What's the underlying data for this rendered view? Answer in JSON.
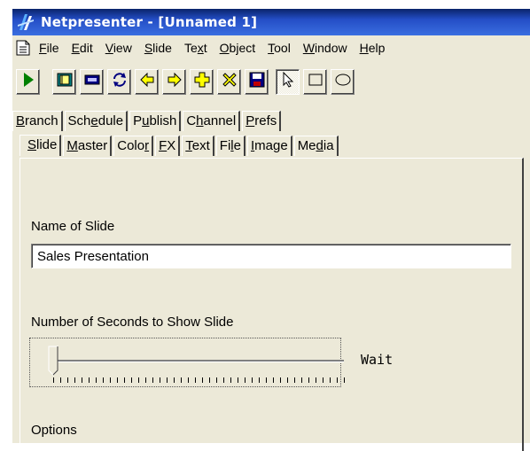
{
  "window": {
    "title": "Netpresenter - [Unnamed 1]"
  },
  "menu": {
    "items": [
      {
        "pre": "",
        "key": "F",
        "post": "ile"
      },
      {
        "pre": "",
        "key": "E",
        "post": "dit"
      },
      {
        "pre": "",
        "key": "V",
        "post": "iew"
      },
      {
        "pre": "",
        "key": "S",
        "post": "lide"
      },
      {
        "pre": "Te",
        "key": "x",
        "post": "t"
      },
      {
        "pre": "",
        "key": "O",
        "post": "bject"
      },
      {
        "pre": "",
        "key": "T",
        "post": "ool"
      },
      {
        "pre": "",
        "key": "W",
        "post": "indow"
      },
      {
        "pre": "",
        "key": "H",
        "post": "elp"
      }
    ]
  },
  "toolbar": {
    "buttons": [
      "play-icon",
      "open-slide-icon",
      "screen-icon",
      "refresh-icon",
      "left-arrow-icon",
      "right-arrow-icon",
      "add-icon",
      "delete-icon",
      "save-icon",
      "pointer-icon",
      "rectangle-icon",
      "ellipse-icon"
    ],
    "colors": {
      "green": "#008000",
      "yellow": "#ffff00",
      "blue": "#0000c0",
      "red": "#c00000"
    }
  },
  "tabs_top": [
    {
      "pre": "",
      "key": "B",
      "post": "ranch"
    },
    {
      "pre": "Sch",
      "key": "e",
      "post": "dule"
    },
    {
      "pre": "P",
      "key": "u",
      "post": "blish"
    },
    {
      "pre": "C",
      "key": "h",
      "post": "annel"
    },
    {
      "pre": "",
      "key": "P",
      "post": "refs"
    }
  ],
  "tabs_bottom": [
    {
      "pre": "",
      "key": "S",
      "post": "lide",
      "active": true
    },
    {
      "pre": "",
      "key": "M",
      "post": "aster"
    },
    {
      "pre": "Colo",
      "key": "r",
      "post": ""
    },
    {
      "pre": "",
      "key": "F",
      "post": "X"
    },
    {
      "pre": "",
      "key": "T",
      "post": "ext"
    },
    {
      "pre": "Fi",
      "key": "l",
      "post": "e"
    },
    {
      "pre": "",
      "key": "I",
      "post": "mage"
    },
    {
      "pre": "Me",
      "key": "d",
      "post": "ia"
    }
  ],
  "slide": {
    "name_label": "Name of Slide",
    "name_value": "Sales Presentation",
    "seconds_label": "Number of Seconds to Show Slide",
    "seconds_value_text": "Wait",
    "seconds_level": 0,
    "options_label": "Options"
  }
}
